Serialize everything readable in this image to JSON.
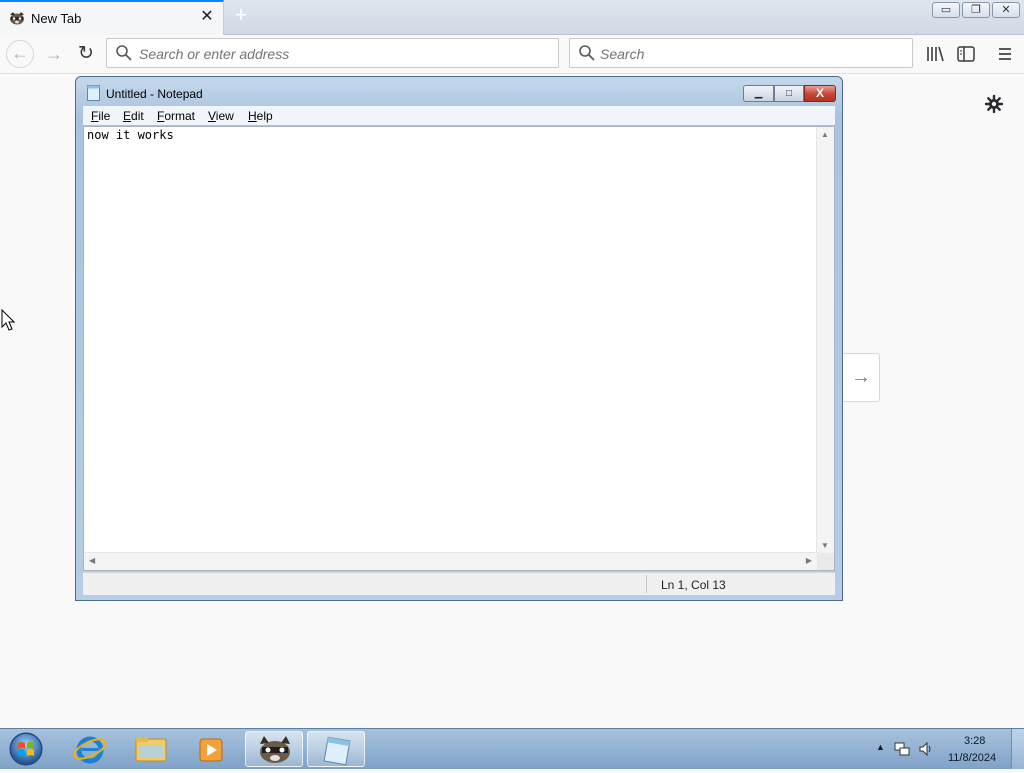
{
  "browser": {
    "tab": {
      "title": "New Tab",
      "close": "✕",
      "favicon": "raccoon-favicon"
    },
    "new_tab_label": "+",
    "window_controls": {
      "minimize": "▭",
      "restore": "❐",
      "close": "✕"
    },
    "nav": {
      "back": "←",
      "forward": "→",
      "reload": "↻"
    },
    "address": {
      "placeholder": "Search or enter address"
    },
    "search": {
      "placeholder": "Search"
    },
    "toolbar_icons": [
      "library-icon",
      "sidebar-icon",
      "menu-icon"
    ],
    "page": {
      "settings_icon": "gear-icon",
      "next_arrow": "→"
    }
  },
  "notepad": {
    "title": "Untitled - Notepad",
    "controls": {
      "minimize": "▁",
      "maximize": "□",
      "close": "X"
    },
    "menu": {
      "file": "File",
      "edit": "Edit",
      "format": "Format",
      "view": "View",
      "help": "Help"
    },
    "content": "now it works",
    "status": {
      "position": "Ln 1, Col 13"
    }
  },
  "taskbar": {
    "items": [
      "start-orb",
      "internet-explorer",
      "file-explorer",
      "media-player",
      "firefox",
      "notepad"
    ],
    "tray": {
      "time": "3:28",
      "date": "11/8/2024",
      "show_hidden": "▲"
    }
  }
}
